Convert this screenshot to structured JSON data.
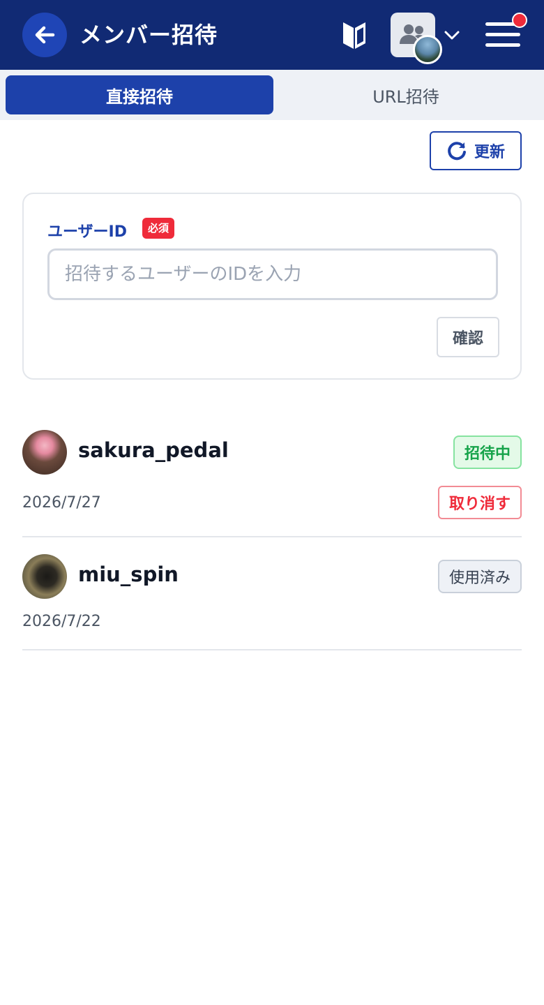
{
  "header": {
    "title": "メンバー招待",
    "back_icon": "arrow-left-icon",
    "beginner_icon": "beginner-mark-icon",
    "group_icon": "users-icon",
    "menu_icon": "hamburger-menu-icon",
    "colors": {
      "bar": "#112a74",
      "accent": "#1d41aa",
      "notification": "#ef2b3a"
    }
  },
  "tabs": [
    {
      "label": "直接招待",
      "active": true
    },
    {
      "label": "URL招待",
      "active": false
    }
  ],
  "refresh": {
    "label": "更新",
    "icon": "refresh-icon"
  },
  "form": {
    "label": "ユーザーID",
    "required_badge": "必須",
    "placeholder": "招待するユーザーのIDを入力",
    "value": "",
    "confirm_label": "確認"
  },
  "invites": [
    {
      "username": "sakura_pedal",
      "date": "2026/7/27",
      "status": "招待中",
      "action_label": "取り消す"
    },
    {
      "username": "miu_spin",
      "date": "2026/7/22",
      "status": "使用済み"
    }
  ]
}
